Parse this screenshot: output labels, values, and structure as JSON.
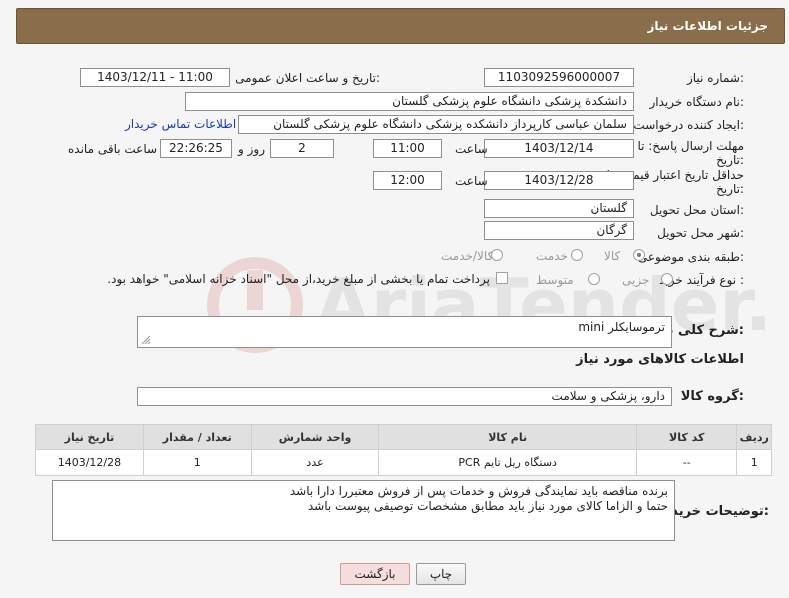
{
  "header": {
    "title": "جزئیات اطلاعات نیاز"
  },
  "form": {
    "need_number": {
      "label": "شماره نیاز:",
      "value": "1103092596000007"
    },
    "announce_datetime": {
      "label": "تاریخ و ساعت اعلان عمومی:",
      "value": "1403/12/11 - 11:00"
    },
    "buyer_org": {
      "label": "نام دستگاه خریدار:",
      "value": "دانشکدة پزشکی دانشگاه علوم پزشکی گلستان"
    },
    "requester": {
      "label": "ایجاد کننده درخواست:",
      "value": "سلمان عباسی کارپرداز دانشکده پزشکی دانشگاه علوم پزشکی گلستان"
    },
    "buyer_contact_link": "اطلاعات تماس خریدار",
    "reply_deadline": {
      "label_line1": "مهلت ارسال پاسخ: تا",
      "label_line2": "تاریخ:",
      "date": "1403/12/14",
      "time_label": "ساعت",
      "time": "11:00",
      "days": "2",
      "days_label": "روز و",
      "remaining": "22:26:25",
      "remaining_label": "ساعت باقی مانده"
    },
    "price_validity": {
      "label_line1": "حداقل تاریخ اعتبار قیمت: تا",
      "label_line2": "تاریخ:",
      "date": "1403/12/28",
      "time_label": "ساعت",
      "time": "12:00"
    },
    "province": {
      "label": "استان محل تحویل:",
      "value": "گلستان"
    },
    "city": {
      "label": "شهر محل تحویل:",
      "value": "گرگان"
    },
    "category": {
      "label": "طبقه بندی موضوعی:",
      "options": [
        "کالا",
        "خدمت",
        "کالا/خدمت"
      ],
      "selected": "کالا"
    },
    "purchase_process": {
      "label": "نوع فرآیند خرید :",
      "options": [
        "جزیی",
        "متوسط"
      ],
      "payment_note": "پرداخت تمام یا بخشی از مبلغ خرید،از محل \"اسناد خزانه اسلامی\" خواهد بود."
    },
    "general_desc": {
      "label": "شرح کلی نیاز:",
      "value": "ترموسایکلر mini"
    },
    "goods_info_title": "اطلاعات کالاهای مورد نیاز",
    "goods_group": {
      "label": "گروه کالا:",
      "value": "دارو، پزشکی و سلامت"
    }
  },
  "table": {
    "headers": [
      "ردیف",
      "کد کالا",
      "نام کالا",
      "واحد شمارش",
      "تعداد / مقدار",
      "تاریخ نیاز"
    ],
    "rows": [
      [
        "1",
        "--",
        "دستگاه ریل تایم PCR",
        "عدد",
        "1",
        "1403/12/28"
      ]
    ]
  },
  "buyer_notes": {
    "label": "توضیحات خریدار:",
    "line1": "برنده مناقصه باید نمایندگی فروش و خدمات پس از فروش معتبررا دارا باشد",
    "line2": "حتما و الزاما کالای مورد  نیاز باید مطابق مشخصات توصیفی پیوست باشد"
  },
  "buttons": {
    "print": "چاپ",
    "back": "بازگشت"
  },
  "colors": {
    "header_bg": "#8a6d4a",
    "back_btn_bg": "#f7dede",
    "link": "#1a3fa8"
  }
}
